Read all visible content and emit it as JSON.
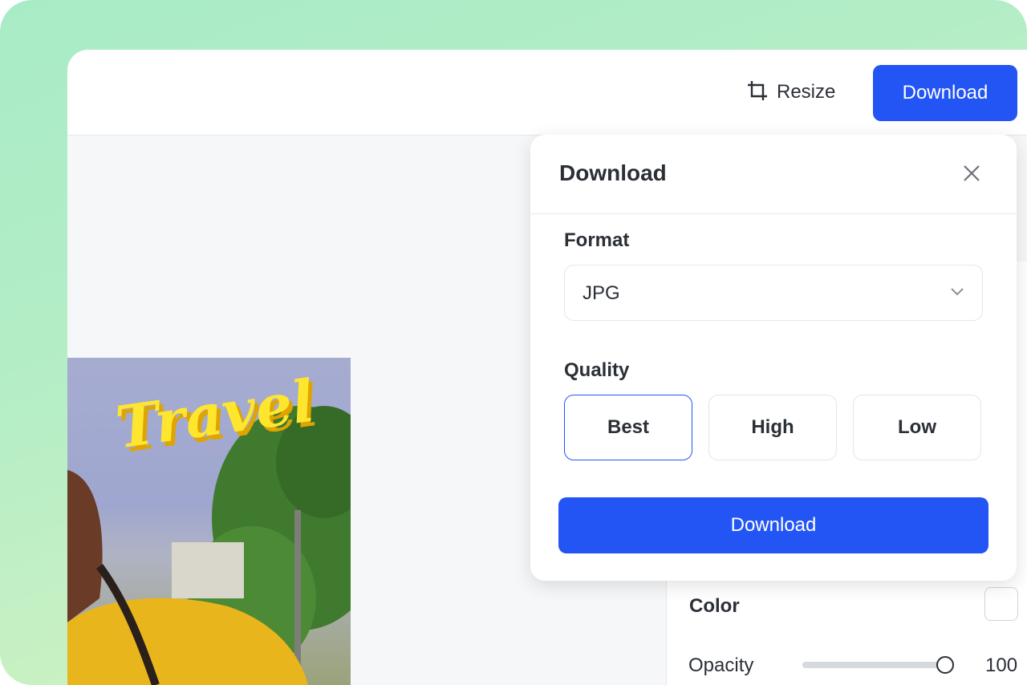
{
  "toolbar": {
    "resize_label": "Resize",
    "download_label": "Download",
    "resize_icon": "crop-icon"
  },
  "canvas": {
    "poster_text": "Travel"
  },
  "download_popup": {
    "title": "Download",
    "close_icon": "close-icon",
    "format_label": "Format",
    "format_value": "JPG",
    "quality_label": "Quality",
    "quality_options": [
      "Best",
      "High",
      "Low"
    ],
    "quality_selected": "Best",
    "download_label": "Download"
  },
  "properties": {
    "color_label": "Color",
    "opacity_label": "Opacity",
    "opacity_value": "100",
    "opacity_fraction": 1.0
  },
  "colors": {
    "accent": "#2355f5",
    "background_gradient_start": "#a8ecc6",
    "background_gradient_end": "#dcf5c0"
  }
}
